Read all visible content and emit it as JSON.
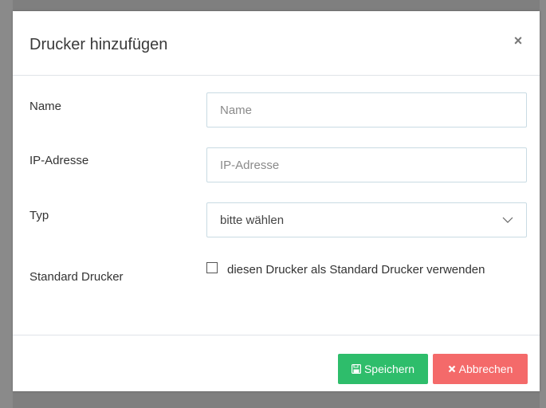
{
  "modal": {
    "title": "Drucker hinzufügen",
    "close_glyph": "×"
  },
  "form": {
    "name": {
      "label": "Name",
      "placeholder": "Name",
      "value": ""
    },
    "ip": {
      "label": "IP-Adresse",
      "placeholder": "IP-Adresse",
      "value": ""
    },
    "type": {
      "label": "Typ",
      "selected": "bitte wählen"
    },
    "default_printer": {
      "label": "Standard Drucker",
      "checkbox_text": "diesen Drucker als Standard Drucker verwenden",
      "checked": false
    }
  },
  "footer": {
    "save_label": "Speichern",
    "save_icon": "floppy-disk-icon",
    "cancel_label": "Abbrechen",
    "cancel_icon": "times-icon"
  },
  "colors": {
    "save": "#2ebd6b",
    "cancel": "#f46a6a",
    "input_border": "#c9dbe3"
  }
}
